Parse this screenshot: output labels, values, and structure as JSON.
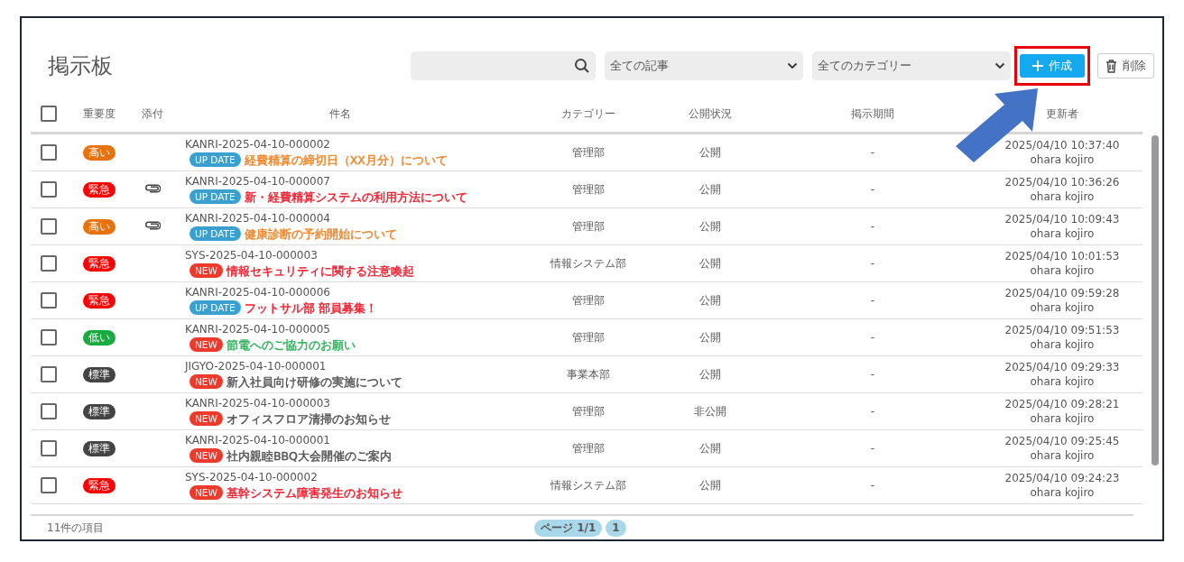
{
  "page": {
    "title": "掲示板"
  },
  "toolbar": {
    "filters": [
      {
        "value": "全ての記事"
      },
      {
        "value": "全てのカテゴリー"
      }
    ],
    "buttons": [
      {
        "kind": "create",
        "label": "作成",
        "highlighted": true
      },
      {
        "kind": "delete",
        "label": "削除",
        "highlighted": false
      }
    ]
  },
  "table": {
    "select_all": {
      "checked": false
    },
    "columns": [
      "重要度",
      "添付",
      "件名",
      "カテゴリー",
      "公開状況",
      "掲示期間",
      "更新者"
    ],
    "rows": [
      {
        "checked": false,
        "priority": {
          "label": "高い",
          "color": "#e8730e"
        },
        "attachment": false,
        "id": "KANRI-2025-04-10-000002",
        "badge": {
          "kind": "update",
          "label": "UP DATE"
        },
        "title": {
          "text": "経費精算の締切日（XX月分）について",
          "color": "#f0862a"
        },
        "category": "管理部",
        "status": "公開",
        "period": "-",
        "updated": "2025/04/10 10:37:40",
        "updater": "ohara kojiro"
      },
      {
        "checked": false,
        "priority": {
          "label": "緊急",
          "color": "#ff0000"
        },
        "attachment": true,
        "id": "KANRI-2025-04-10-000007",
        "badge": {
          "kind": "update",
          "label": "UP DATE"
        },
        "title": {
          "text": "新・経費精算システムの利用方法について",
          "color": "#f01c2c"
        },
        "category": "管理部",
        "status": "公開",
        "period": "-",
        "updated": "2025/04/10 10:36:26",
        "updater": "ohara kojiro"
      },
      {
        "checked": false,
        "priority": {
          "label": "高い",
          "color": "#e8730e"
        },
        "attachment": true,
        "id": "KANRI-2025-04-10-000004",
        "badge": {
          "kind": "update",
          "label": "UP DATE"
        },
        "title": {
          "text": "健康診断の予約開始について",
          "color": "#f0862a"
        },
        "category": "管理部",
        "status": "公開",
        "period": "-",
        "updated": "2025/04/10 10:09:43",
        "updater": "ohara kojiro"
      },
      {
        "checked": false,
        "priority": {
          "label": "緊急",
          "color": "#ff0000"
        },
        "attachment": false,
        "id": "SYS-2025-04-10-000003",
        "badge": {
          "kind": "new",
          "label": "NEW"
        },
        "title": {
          "text": "情報セキュリティに関する注意喚起",
          "color": "#f01c2c"
        },
        "category": "情報システム部",
        "status": "公開",
        "period": "-",
        "updated": "2025/04/10 10:01:53",
        "updater": "ohara kojiro"
      },
      {
        "checked": false,
        "priority": {
          "label": "緊急",
          "color": "#ff0000"
        },
        "attachment": false,
        "id": "KANRI-2025-04-10-000006",
        "badge": {
          "kind": "update",
          "label": "UP DATE"
        },
        "title": {
          "text": "フットサル部 部員募集！",
          "color": "#f01c2c"
        },
        "category": "管理部",
        "status": "公開",
        "period": "-",
        "updated": "2025/04/10 09:59:28",
        "updater": "ohara kojiro"
      },
      {
        "checked": false,
        "priority": {
          "label": "低い",
          "color": "#1aab40"
        },
        "attachment": false,
        "id": "KANRI-2025-04-10-000005",
        "badge": {
          "kind": "new",
          "label": "NEW"
        },
        "title": {
          "text": "節電へのご協力のお願い",
          "color": "#2fb35a"
        },
        "category": "管理部",
        "status": "公開",
        "period": "-",
        "updated": "2025/04/10 09:51:53",
        "updater": "ohara kojiro"
      },
      {
        "checked": false,
        "priority": {
          "label": "標準",
          "color": "#444444"
        },
        "attachment": false,
        "id": "JIGYO-2025-04-10-000001",
        "badge": {
          "kind": "new",
          "label": "NEW"
        },
        "title": {
          "text": "新入社員向け研修の実施について",
          "color": "#555555"
        },
        "category": "事業本部",
        "status": "公開",
        "period": "-",
        "updated": "2025/04/10 09:29:33",
        "updater": "ohara kojiro"
      },
      {
        "checked": false,
        "priority": {
          "label": "標準",
          "color": "#444444"
        },
        "attachment": false,
        "id": "KANRI-2025-04-10-000003",
        "badge": {
          "kind": "new",
          "label": "NEW"
        },
        "title": {
          "text": "オフィスフロア清掃のお知らせ",
          "color": "#555555"
        },
        "category": "管理部",
        "status": "非公開",
        "period": "-",
        "updated": "2025/04/10 09:28:21",
        "updater": "ohara kojiro"
      },
      {
        "checked": false,
        "priority": {
          "label": "標準",
          "color": "#444444"
        },
        "attachment": false,
        "id": "KANRI-2025-04-10-000001",
        "badge": {
          "kind": "new",
          "label": "NEW"
        },
        "title": {
          "text": "社内親睦BBQ大会開催のご案内",
          "color": "#555555"
        },
        "category": "管理部",
        "status": "公開",
        "period": "-",
        "updated": "2025/04/10 09:25:45",
        "updater": "ohara kojiro"
      },
      {
        "checked": false,
        "priority": {
          "label": "緊急",
          "color": "#ff0000"
        },
        "attachment": false,
        "id": "SYS-2025-04-10-000002",
        "badge": {
          "kind": "new",
          "label": "NEW"
        },
        "title": {
          "text": "基幹システム障害発生のお知らせ",
          "color": "#f01c2c"
        },
        "category": "情報システム部",
        "status": "公開",
        "period": "-",
        "updated": "2025/04/10 09:24:23",
        "updater": "ohara kojiro"
      }
    ]
  },
  "footer": {
    "count": "11件の項目",
    "pagination": [
      {
        "label": "ページ 1/1"
      },
      {
        "label": "1"
      }
    ]
  }
}
